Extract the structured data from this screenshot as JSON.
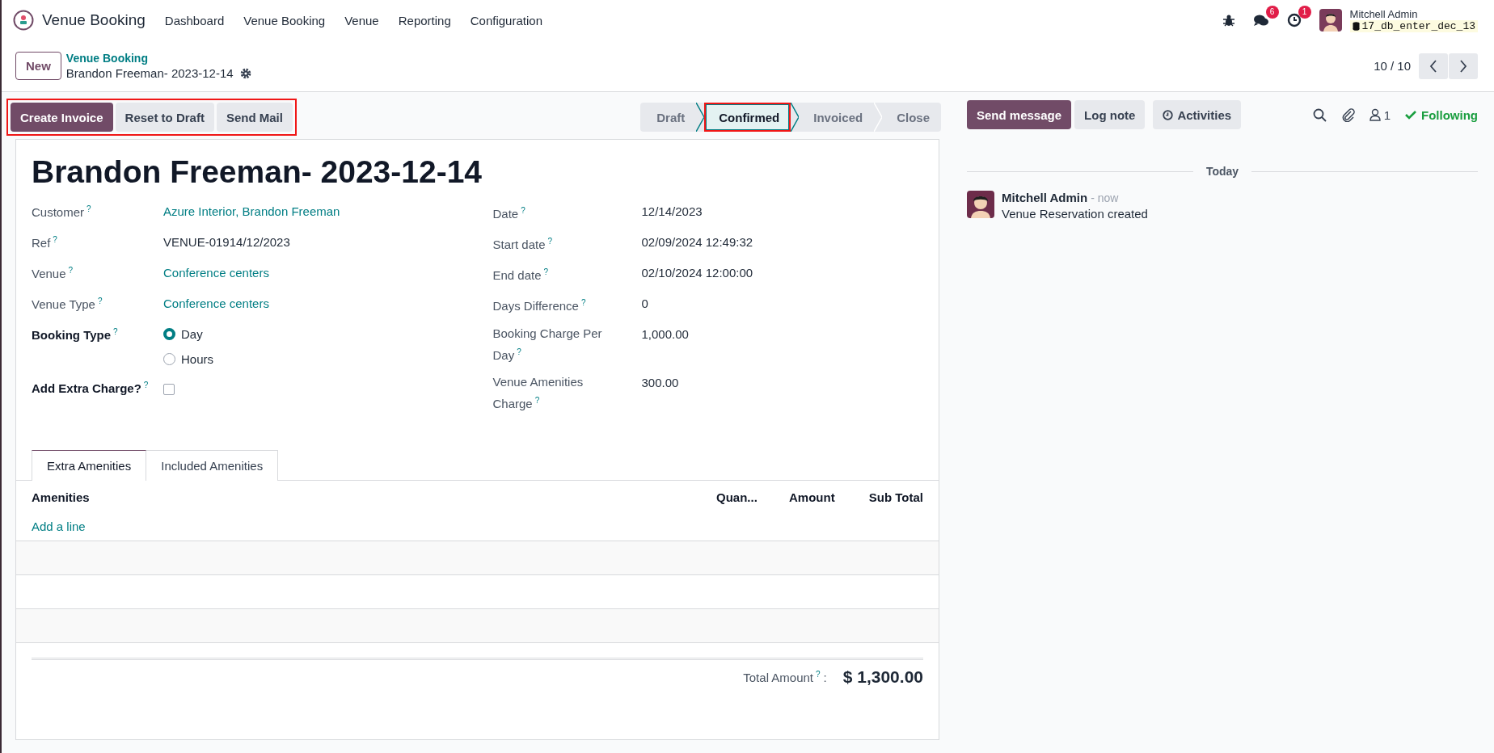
{
  "navbar": {
    "app_name": "Venue Booking",
    "menu": [
      "Dashboard",
      "Venue Booking",
      "Venue",
      "Reporting",
      "Configuration"
    ],
    "chat_count": "6",
    "activity_count": "1",
    "user": {
      "name": "Mitchell Admin",
      "database": "17_db_enter_dec_13"
    }
  },
  "control_panel": {
    "new_button": "New",
    "breadcrumb_parent": "Venue Booking",
    "breadcrumb_current": "Brandon Freeman- 2023-12-14",
    "pager": "10 / 10"
  },
  "action_buttons": [
    {
      "label": "Create Invoice",
      "primary": true
    },
    {
      "label": "Reset to Draft",
      "primary": false
    },
    {
      "label": "Send Mail",
      "primary": false
    }
  ],
  "action_buttons_highlighted": true,
  "stages": [
    {
      "label": "Draft",
      "selected": false,
      "highlighted": false
    },
    {
      "label": "Confirmed",
      "selected": true,
      "highlighted": true
    },
    {
      "label": "Invoiced",
      "selected": false,
      "highlighted": false
    },
    {
      "label": "Close",
      "selected": false,
      "highlighted": false
    }
  ],
  "form": {
    "title": "Brandon Freeman- 2023-12-14",
    "left_fields": [
      {
        "label": "Customer",
        "help": "?",
        "required": false,
        "kind": "link",
        "value": "Azure Interior, Brandon Freeman"
      },
      {
        "label": "Ref",
        "help": "?",
        "required": false,
        "kind": "text",
        "value": "VENUE-01914/12/2023"
      },
      {
        "label": "Venue",
        "help": "?",
        "required": false,
        "kind": "link",
        "value": "Conference centers"
      },
      {
        "label": "Venue Type",
        "help": "?",
        "required": false,
        "kind": "link",
        "value": "Conference centers"
      },
      {
        "label": "Booking Type",
        "help": "?",
        "required": true,
        "kind": "radio",
        "options": [
          {
            "label": "Day",
            "selected": true
          },
          {
            "label": "Hours",
            "selected": false
          }
        ]
      },
      {
        "label": "Add Extra Charge?",
        "help": "?",
        "required": true,
        "kind": "checkbox",
        "checked": false
      }
    ],
    "right_fields": [
      {
        "label": "Date",
        "help": "?",
        "value": "12/14/2023"
      },
      {
        "label": "Start date",
        "help": "?",
        "value": "02/09/2024 12:49:32"
      },
      {
        "label": "End date",
        "help": "?",
        "value": "02/10/2024 12:00:00"
      },
      {
        "label": "Days Difference",
        "help": "?",
        "value": "0"
      },
      {
        "label": "Booking Charge Per Day",
        "help": "?",
        "value": "1,000.00"
      },
      {
        "label": "Venue Amenities Charge",
        "help": "?",
        "value": "300.00"
      }
    ],
    "tabs": [
      {
        "label": "Extra Amenities",
        "selected": true
      },
      {
        "label": "Included Amenities",
        "selected": false
      }
    ],
    "table": {
      "columns": [
        "Amenities",
        "Quan...",
        "Amount",
        "Sub Total"
      ],
      "add_line": "Add a line"
    },
    "total": {
      "label": "Total Amount",
      "help": "?",
      "separator": ":",
      "value": "$ 1,300.00"
    }
  },
  "chatter": {
    "buttons": [
      {
        "label": "Send message",
        "primary": true,
        "kind": "plain"
      },
      {
        "label": "Log note",
        "primary": false,
        "kind": "plain"
      },
      {
        "label": "Activities",
        "primary": false,
        "kind": "clock"
      }
    ],
    "followers": "1",
    "following": "Following",
    "date_separator": "Today",
    "messages": [
      {
        "author": "Mitchell Admin",
        "time": "- now",
        "body": "Venue Reservation created"
      }
    ]
  }
}
